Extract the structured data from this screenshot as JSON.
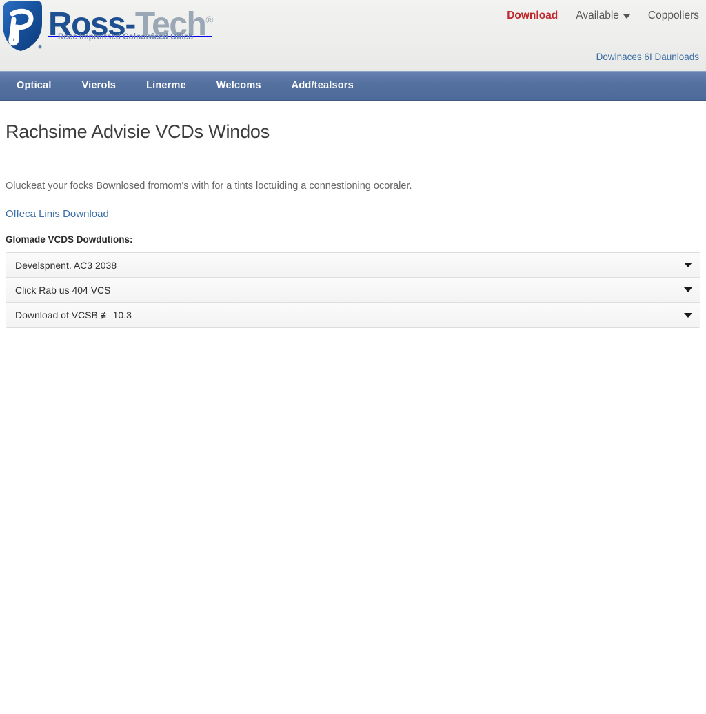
{
  "brand": {
    "logo_icon": "ross-tech-shield-r-logo",
    "name_part1": "Ross",
    "name_dash": "-",
    "name_part2": "Tech",
    "registered_mark": "®",
    "tagline": "Recc Improitsed Colnowiced Oificb"
  },
  "colors": {
    "nav_bar": "#4f6fa8",
    "accent_red": "#c0282d",
    "link_blue": "#3a6ea5",
    "brand_blue": "#1d4f91",
    "brand_grey": "#9aa7b4",
    "header_bg": "#eeeeec"
  },
  "util_nav": {
    "items": [
      {
        "label": "Download",
        "style": "accent",
        "has_caret": false
      },
      {
        "label": "Available",
        "style": "normal",
        "has_caret": true
      },
      {
        "label": "Coppoliers",
        "style": "normal",
        "has_caret": false
      }
    ],
    "sub_link": "Dowinaces 6I Daunloads"
  },
  "main_nav": {
    "items": [
      {
        "label": "Optical"
      },
      {
        "label": "Vierols"
      },
      {
        "label": "Linerme"
      },
      {
        "label": "Welcoms"
      },
      {
        "label": "Add/tealsors"
      }
    ]
  },
  "main": {
    "title": "Rachsime Advisie VCDs Windos",
    "intro": "Oluckeat your focks Bownlosed fromom's with for a tints loctuiding a connestioning ocoraler.",
    "primary_link": "Offeca Linis Download",
    "section_label": "Glomade VCDS Dowdutions:",
    "accordion": [
      {
        "label": "Develspnent. AC3 2038",
        "icon": "chevron-down-icon",
        "expanded": false
      },
      {
        "label": "Click Rab us 404 VCS",
        "icon": "chevron-down-icon",
        "expanded": false
      },
      {
        "label": "Download of VCSB ≢ 10.3",
        "icon": "chevron-down-icon",
        "expanded": false
      }
    ]
  }
}
